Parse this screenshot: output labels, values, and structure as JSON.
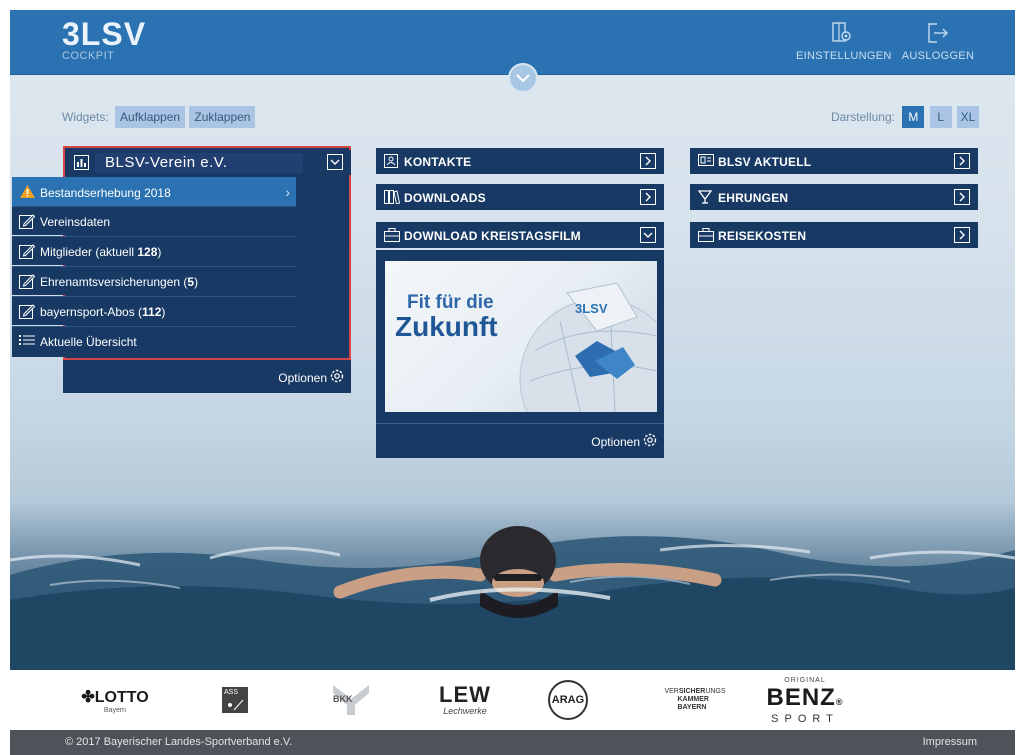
{
  "header": {
    "logo_text": "3LSV",
    "logo_sub": "COCKPIT",
    "settings_label": "EINSTELLUNGEN",
    "logout_label": "AUSLOGGEN"
  },
  "toolbar": {
    "widgets_label": "Widgets:",
    "expand_label": "Aufklappen",
    "collapse_label": "Zuklappen",
    "display_label": "Darstellung:",
    "sizes": [
      "M",
      "L",
      "XL"
    ],
    "active_size": "M"
  },
  "club_widget": {
    "title": "BLSV-Verein e.V.",
    "items": [
      {
        "label": "Bestandserhebung 2018",
        "icon": "warning-icon",
        "highlight": true
      },
      {
        "label": "Vereinsdaten",
        "icon": "edit-icon"
      },
      {
        "label": "Mitglieder (aktuell ",
        "num": "128",
        "suffix": ")",
        "icon": "edit-icon"
      },
      {
        "label": "Ehrenamtsversicherungen (",
        "num": "5",
        "suffix": ")",
        "icon": "edit-icon"
      },
      {
        "label": "bayernsport-Abos (",
        "num": "112",
        "suffix": ")",
        "icon": "edit-icon"
      },
      {
        "label": "Aktuelle Übersicht",
        "icon": "list-icon"
      }
    ],
    "options_label": "Optionen"
  },
  "middle_widgets": {
    "contacts": "KONTAKTE",
    "downloads": "DOWNLOADS",
    "film": "DOWNLOAD KREISTAGSFILM",
    "film_image_line1": "Fit für die",
    "film_image_line2": "Zukunft",
    "film_image_logo": "3LSV",
    "options_label": "Optionen"
  },
  "right_widgets": {
    "news": "BLSV AKTUELL",
    "honors": "EHRUNGEN",
    "travel": "REISEKOSTEN"
  },
  "sponsors": {
    "lotto": "LOTTO",
    "lotto_sub": "Bayern",
    "ass": "ASS",
    "bkk": "BKK",
    "lew": "LEW",
    "lew_sub": "Lechwerke",
    "arag": "ARAG",
    "vk_1": "VER",
    "vk_2": "SICHER",
    "vk_3": "UNGS",
    "vk_4": "KAMMER",
    "vk_5": "BAYERN",
    "benz_top": "ORIGINAL",
    "benz": "BENZ",
    "benz_sub": "SPORT"
  },
  "footer": {
    "copyright": "© 2017 Bayerischer Landes-Sportverband e.V.",
    "impressum": "Impressum"
  }
}
